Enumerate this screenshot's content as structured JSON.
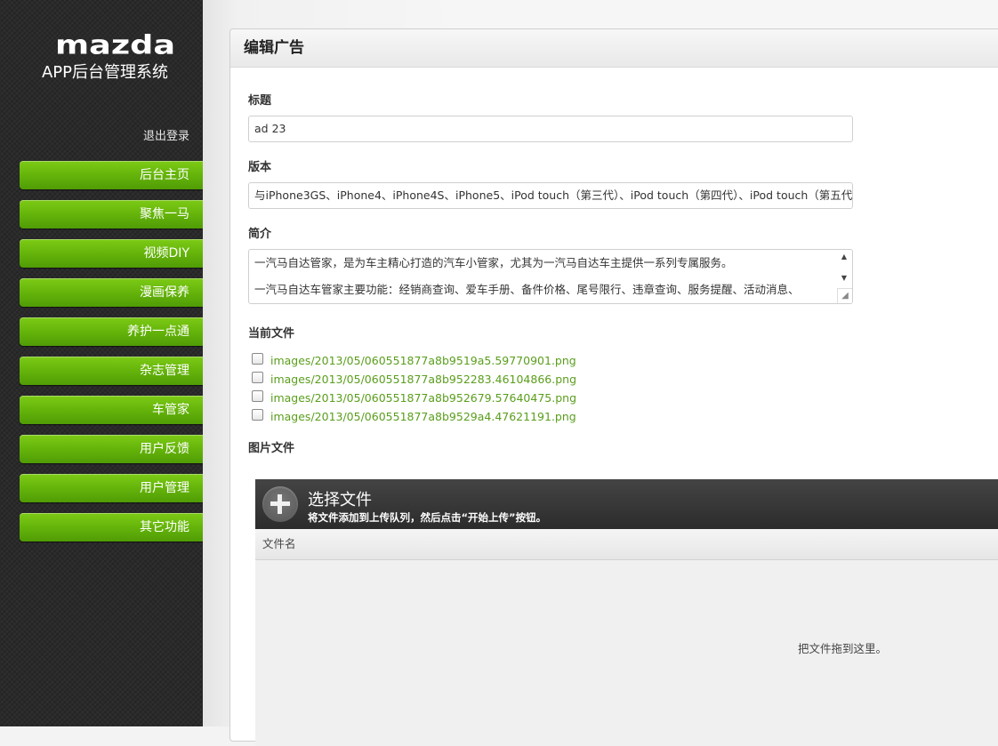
{
  "brand": {
    "logo": "mazda",
    "subtitle": "APP后台管理系统"
  },
  "sidebar": {
    "logout": "退出登录",
    "items": [
      {
        "label": "后台主页"
      },
      {
        "label": "聚焦一马"
      },
      {
        "label": "视频DIY"
      },
      {
        "label": "漫画保养"
      },
      {
        "label": "养护一点通"
      },
      {
        "label": "杂志管理"
      },
      {
        "label": "车管家"
      },
      {
        "label": "用户反馈"
      },
      {
        "label": "用户管理"
      },
      {
        "label": "其它功能"
      }
    ]
  },
  "form": {
    "heading": "编辑广告",
    "title_label": "标题",
    "title_value": "ad 23",
    "version_label": "版本",
    "version_value": "与iPhone3GS、iPhone4、iPhone4S、iPhone5、iPod touch（第三代）、iPod touch（第四代）、iPod touch（第五代",
    "intro_label": "简介",
    "intro_lines": [
      "一汽马自达管家，是为车主精心打造的汽车小管家，尤其为一汽马自达车主提供一系列专属服务。",
      "一汽马自达车管家主要功能：经销商查询、爱车手册、备件价格、尾号限行、违章查询、服务提醒、活动消息、"
    ],
    "current_files_label": "当前文件",
    "current_files": [
      "images/2013/05/060551877a8b9519a5.59770901.png",
      "images/2013/05/060551877a8b952283.46104866.png",
      "images/2013/05/060551877a8b952679.57640475.png",
      "images/2013/05/060551877a8b9529a4.47621191.png"
    ],
    "image_files_label": "图片文件"
  },
  "uploader": {
    "title": "选择文件",
    "subtitle": "将文件添加到上传队列，然后点击“开始上传”按钮。",
    "column_filename": "文件名",
    "drop_text": "把文件拖到这里。"
  },
  "colors": {
    "nav_green": "#65b40a",
    "file_link": "#5a9e1c",
    "sidebar_bg": "#2a2a2a"
  }
}
